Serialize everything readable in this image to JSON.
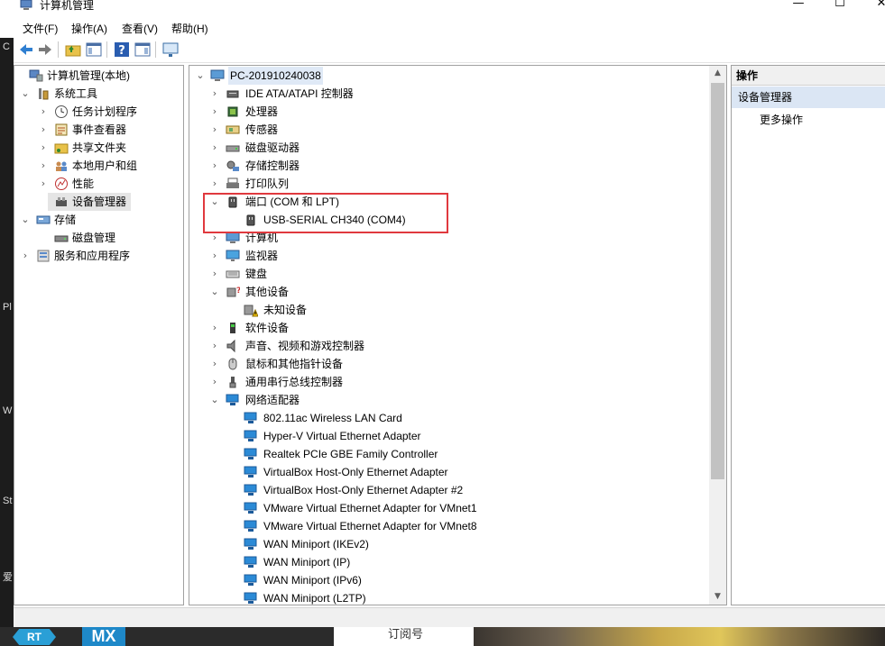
{
  "window": {
    "title": "计算机管理"
  },
  "menu": [
    "文件(F)",
    "操作(A)",
    "查看(V)",
    "帮助(H)"
  ],
  "left_strip": [
    "C",
    "Pl",
    "W",
    "St",
    "爱"
  ],
  "left_tree": [
    {
      "label": "计算机管理(本地)",
      "icon": "computer-management-icon",
      "indent": 0,
      "chevron": ""
    },
    {
      "label": "系统工具",
      "icon": "tools-icon",
      "indent": 1,
      "chevron": "v"
    },
    {
      "label": "任务计划程序",
      "icon": "clock-icon",
      "indent": 2,
      "chevron": ">"
    },
    {
      "label": "事件查看器",
      "icon": "event-viewer-icon",
      "indent": 2,
      "chevron": ">"
    },
    {
      "label": "共享文件夹",
      "icon": "shared-folder-icon",
      "indent": 2,
      "chevron": ">"
    },
    {
      "label": "本地用户和组",
      "icon": "users-icon",
      "indent": 2,
      "chevron": ">"
    },
    {
      "label": "性能",
      "icon": "performance-icon",
      "indent": 2,
      "chevron": ">"
    },
    {
      "label": "设备管理器",
      "icon": "device-manager-icon",
      "indent": 2,
      "chevron": "",
      "selected": true
    },
    {
      "label": "存储",
      "icon": "storage-icon",
      "indent": 1,
      "chevron": "v"
    },
    {
      "label": "磁盘管理",
      "icon": "disk-icon",
      "indent": 2,
      "chevron": ""
    },
    {
      "label": "服务和应用程序",
      "icon": "services-icon",
      "indent": 1,
      "chevron": ">"
    }
  ],
  "device_tree": {
    "root": "PC-201910240038",
    "items": [
      {
        "label": "IDE ATA/ATAPI 控制器",
        "icon": "ide-controller-icon",
        "indent": 1,
        "chevron": ">"
      },
      {
        "label": "处理器",
        "icon": "processor-icon",
        "indent": 1,
        "chevron": ">"
      },
      {
        "label": "传感器",
        "icon": "sensor-icon",
        "indent": 1,
        "chevron": ">"
      },
      {
        "label": "磁盘驱动器",
        "icon": "disk-drive-icon",
        "indent": 1,
        "chevron": ">"
      },
      {
        "label": "存储控制器",
        "icon": "storage-controller-icon",
        "indent": 1,
        "chevron": ">"
      },
      {
        "label": "打印队列",
        "icon": "printer-icon",
        "indent": 1,
        "chevron": ">"
      },
      {
        "label": "端口 (COM 和 LPT)",
        "icon": "port-icon",
        "indent": 1,
        "chevron": "v"
      },
      {
        "label": "USB-SERIAL CH340 (COM4)",
        "icon": "port-icon",
        "indent": 2,
        "chevron": ""
      },
      {
        "label": "计算机",
        "icon": "computer-icon",
        "indent": 1,
        "chevron": ">"
      },
      {
        "label": "监视器",
        "icon": "monitor-icon",
        "indent": 1,
        "chevron": ">"
      },
      {
        "label": "键盘",
        "icon": "keyboard-icon",
        "indent": 1,
        "chevron": ">"
      },
      {
        "label": "其他设备",
        "icon": "other-devices-icon",
        "indent": 1,
        "chevron": "v"
      },
      {
        "label": "未知设备",
        "icon": "warning-device-icon",
        "indent": 2,
        "chevron": ""
      },
      {
        "label": "软件设备",
        "icon": "software-device-icon",
        "indent": 1,
        "chevron": ">"
      },
      {
        "label": "声音、视频和游戏控制器",
        "icon": "speaker-icon",
        "indent": 1,
        "chevron": ">"
      },
      {
        "label": "鼠标和其他指针设备",
        "icon": "mouse-icon",
        "indent": 1,
        "chevron": ">"
      },
      {
        "label": "通用串行总线控制器",
        "icon": "usb-icon",
        "indent": 1,
        "chevron": ">"
      },
      {
        "label": "网络适配器",
        "icon": "network-adapter-icon",
        "indent": 1,
        "chevron": "v"
      },
      {
        "label": "802.11ac Wireless LAN Card",
        "icon": "network-adapter-icon",
        "indent": 2,
        "chevron": ""
      },
      {
        "label": "Hyper-V Virtual Ethernet Adapter",
        "icon": "network-adapter-icon",
        "indent": 2,
        "chevron": ""
      },
      {
        "label": "Realtek PCIe GBE Family Controller",
        "icon": "network-adapter-icon",
        "indent": 2,
        "chevron": ""
      },
      {
        "label": "VirtualBox Host-Only Ethernet Adapter",
        "icon": "network-adapter-icon",
        "indent": 2,
        "chevron": ""
      },
      {
        "label": "VirtualBox Host-Only Ethernet Adapter #2",
        "icon": "network-adapter-icon",
        "indent": 2,
        "chevron": ""
      },
      {
        "label": "VMware Virtual Ethernet Adapter for VMnet1",
        "icon": "network-adapter-icon",
        "indent": 2,
        "chevron": ""
      },
      {
        "label": "VMware Virtual Ethernet Adapter for VMnet8",
        "icon": "network-adapter-icon",
        "indent": 2,
        "chevron": ""
      },
      {
        "label": "WAN Miniport (IKEv2)",
        "icon": "network-adapter-icon",
        "indent": 2,
        "chevron": ""
      },
      {
        "label": "WAN Miniport (IP)",
        "icon": "network-adapter-icon",
        "indent": 2,
        "chevron": ""
      },
      {
        "label": "WAN Miniport (IPv6)",
        "icon": "network-adapter-icon",
        "indent": 2,
        "chevron": ""
      },
      {
        "label": "WAN Miniport (L2TP)",
        "icon": "network-adapter-icon",
        "indent": 2,
        "chevron": ""
      }
    ]
  },
  "actions": {
    "header": "操作",
    "section": "设备管理器",
    "more": "更多操作"
  },
  "taskbar": {
    "rt_label": "RT",
    "mx_label": "MX",
    "window_label": "订阅号"
  },
  "colors": {
    "highlight_border": "#e0393e",
    "selection": "#e5e5e5",
    "action_section_bg": "#dbe6f4"
  }
}
